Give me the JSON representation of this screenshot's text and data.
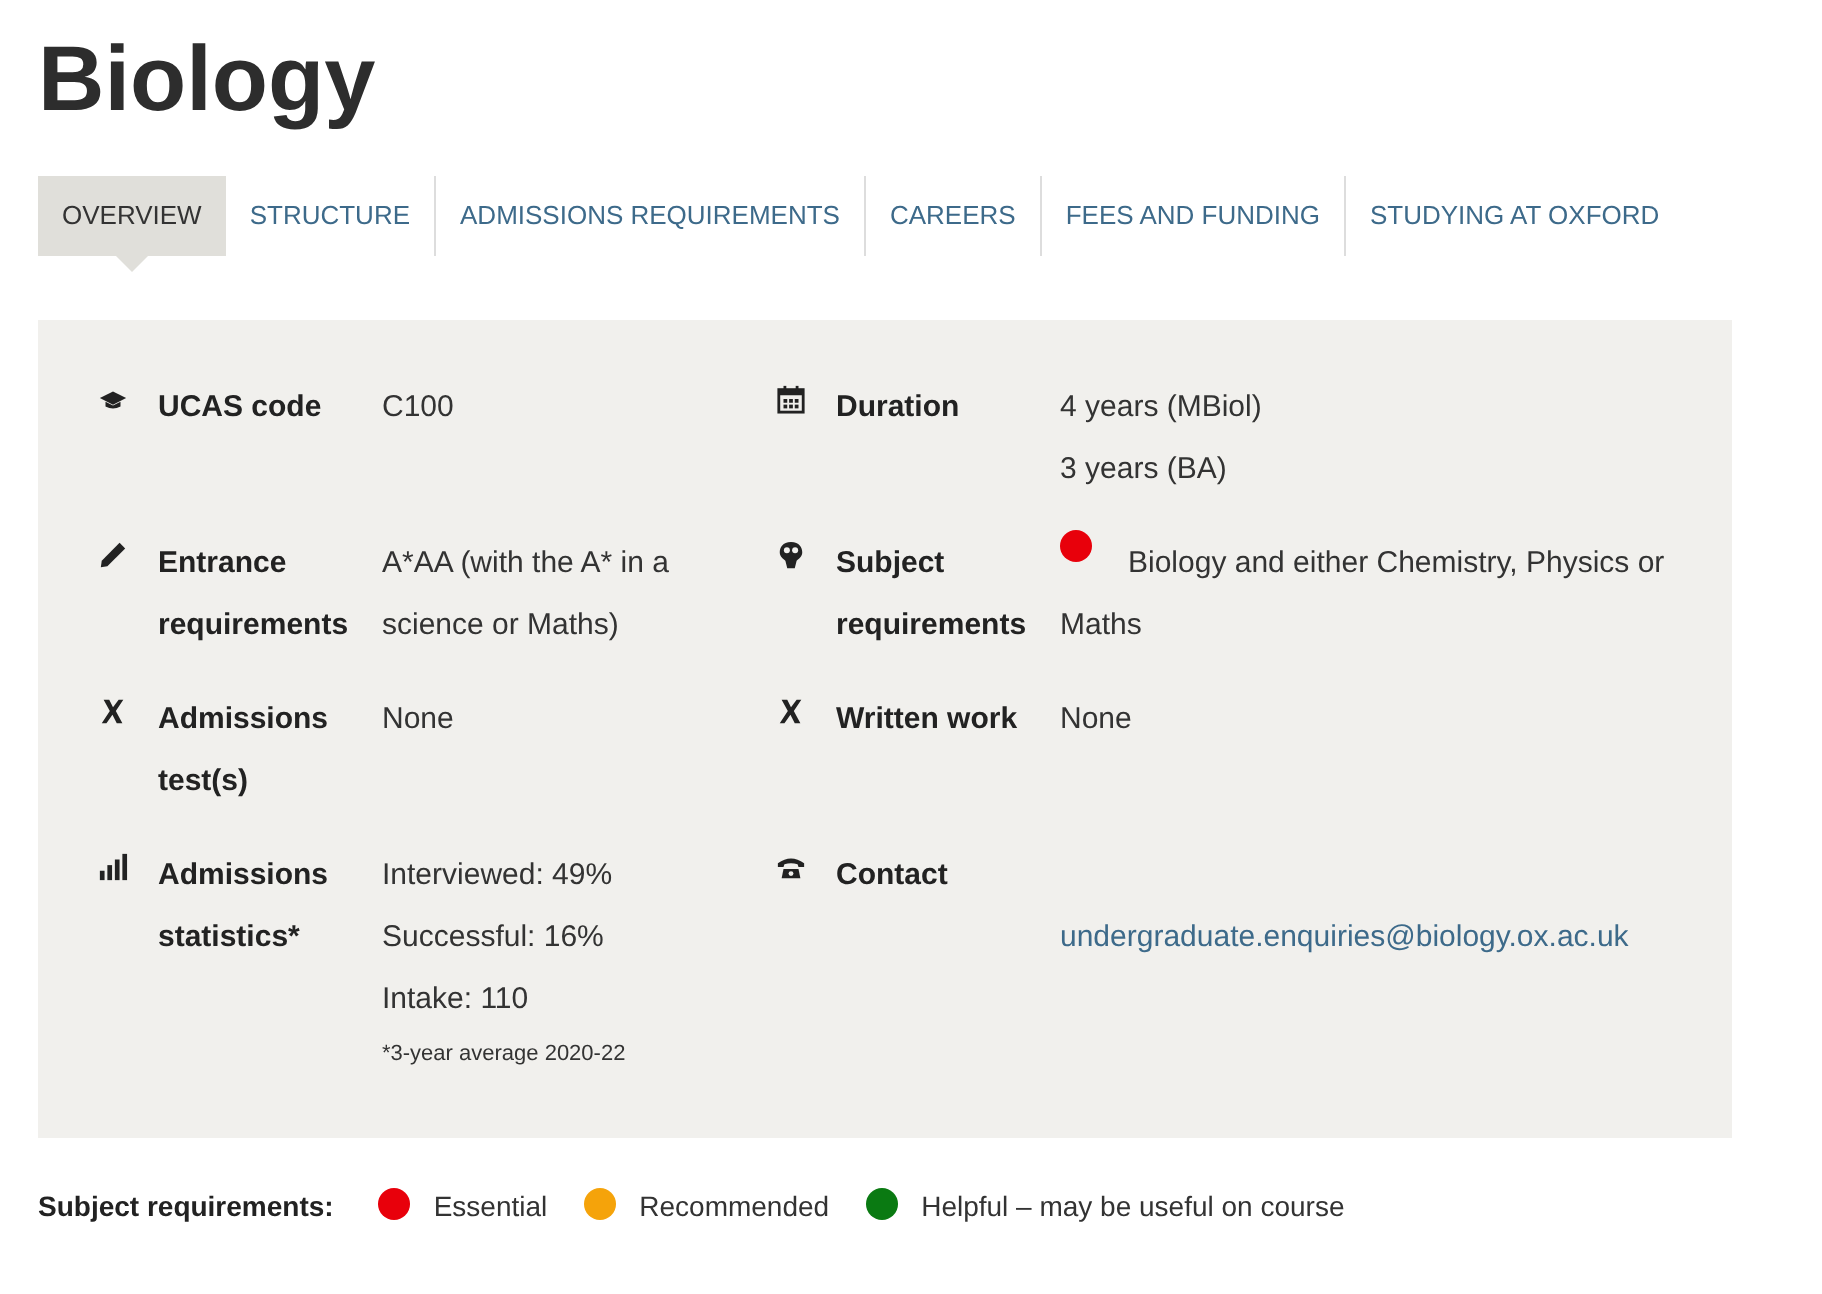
{
  "title": "Biology",
  "tabs": [
    {
      "label": "OVERVIEW",
      "selected": true
    },
    {
      "label": "STRUCTURE",
      "selected": false
    },
    {
      "label": "ADMISSIONS REQUIREMENTS",
      "selected": false
    },
    {
      "label": "CAREERS",
      "selected": false
    },
    {
      "label": "FEES AND FUNDING",
      "selected": false
    },
    {
      "label": "STUDYING AT OXFORD",
      "selected": false
    }
  ],
  "facts": [
    {
      "label": "UCAS code",
      "values": [
        {
          "kind": "text",
          "text": "C100"
        }
      ]
    },
    {
      "label": "Duration",
      "values": [
        {
          "kind": "text",
          "text": "4 years (MBiol)"
        },
        {
          "kind": "text",
          "text": "3 years (BA)"
        }
      ]
    },
    {
      "label": "Entrance requirements",
      "values": [
        {
          "kind": "text",
          "text": "A*AA (with the A* in a science or Maths)"
        }
      ]
    },
    {
      "label": "Subject requirements",
      "values": [
        {
          "kind": "requirement",
          "color": "#e8000b",
          "text": "Biology and either Chemistry, Physics or Maths"
        }
      ]
    },
    {
      "label": "Admissions test(s)",
      "values": [
        {
          "kind": "text",
          "text": "None"
        }
      ]
    },
    {
      "label": "Written work",
      "values": [
        {
          "kind": "text",
          "text": "None"
        }
      ]
    },
    {
      "label": "Admissions statistics*",
      "values": [
        {
          "kind": "text",
          "text": "Interviewed: 49%"
        },
        {
          "kind": "text",
          "text": "Successful: 16%"
        },
        {
          "kind": "text",
          "text": "Intake: 110"
        },
        {
          "kind": "note",
          "text": "*3-year average 2020-22"
        }
      ]
    },
    {
      "label": "Contact",
      "values": [
        {
          "kind": "email",
          "text": "undergraduate.enquiries@biology.ox.ac.uk"
        }
      ]
    }
  ],
  "legend": {
    "label": "Subject requirements:",
    "items": [
      {
        "label": "Essential",
        "color": "#e8000b"
      },
      {
        "label": "Recommended",
        "color": "#f5a30a"
      },
      {
        "label": "Helpful – may be useful on course",
        "color": "#0a7a12"
      }
    ]
  }
}
